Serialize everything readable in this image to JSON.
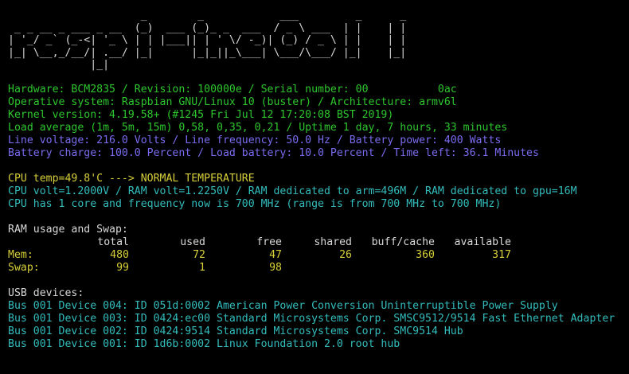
{
  "banner": [
    "                     _        _            ___         _      _",
    " _ _ __ _ ___ _ __  (_)  ___ (_)_ _  ___  / _ \\ ___  | |    | |",
    "| '_/ _` (_-<| '_ \\ | | |___|| | ' \\/ -_)| (_) / _ \\ | |    | |",
    "|_| \\__,_/__/| .__/ |_|      |_|_||_\\___| \\___/\\___/ |_|    |_|",
    "             |_|"
  ],
  "system": {
    "hardware": "Hardware: BCM2835 / Revision: 100000e / Serial number: 00           0ac",
    "os": "Operative system: Raspbian GNU/Linux 10 (buster) / Architecture: armv6l",
    "kernel": "Kernel version: 4.19.58+ (#1245 Fri Jul 12 17:20:08 BST 2019)",
    "load": "Load average (1m, 5m, 15m) 0,58, 0,35, 0,21 / Uptime 1 day, 7 hours, 33 minutes",
    "power": "Line voltage: 216.0 Volts / Line frequency: 50.0 Hz / Battery power: 400 Watts",
    "battery": "Battery charge: 100.0 Percent / Load battery: 10.0 Percent / Time left: 36.1 Minutes"
  },
  "cpu": {
    "temp": "CPU temp=49.8'C ---> NORMAL TEMPERATURE",
    "volt": "CPU volt=1.2000V / RAM volt=1.2250V / RAM dedicated to arm=496M / RAM dedicated to gpu=16M",
    "freq": "CPU has 1 core and frequency now is 700 MHz (range is from 700 MHz to 700 MHz)"
  },
  "memory": {
    "title": "RAM usage and Swap:",
    "headers": [
      "",
      "total",
      "used",
      "free",
      "shared",
      "buff/cache",
      "available"
    ],
    "mem": [
      "Mem:",
      "480",
      "72",
      "47",
      "26",
      "360",
      "317"
    ],
    "swap": [
      "Swap:",
      "99",
      "1",
      "98",
      "",
      "",
      ""
    ]
  },
  "usb": {
    "title": "USB devices:",
    "devices": [
      "Bus 001 Device 004: ID 051d:0002 American Power Conversion Uninterruptible Power Supply",
      "Bus 001 Device 003: ID 0424:ec00 Standard Microsystems Corp. SMSC9512/9514 Fast Ethernet Adapter",
      "Bus 001 Device 002: ID 0424:9514 Standard Microsystems Corp. SMC9514 Hub",
      "Bus 001 Device 001: ID 1d6b:0002 Linux Foundation 2.0 root hub"
    ]
  },
  "colors": {
    "background": "#000000",
    "banner": "#d8d8d8",
    "system": "#2ec62e",
    "power": "#7a6cf0",
    "cpu": "#d6cf3a",
    "usb": "#34bcbc"
  }
}
